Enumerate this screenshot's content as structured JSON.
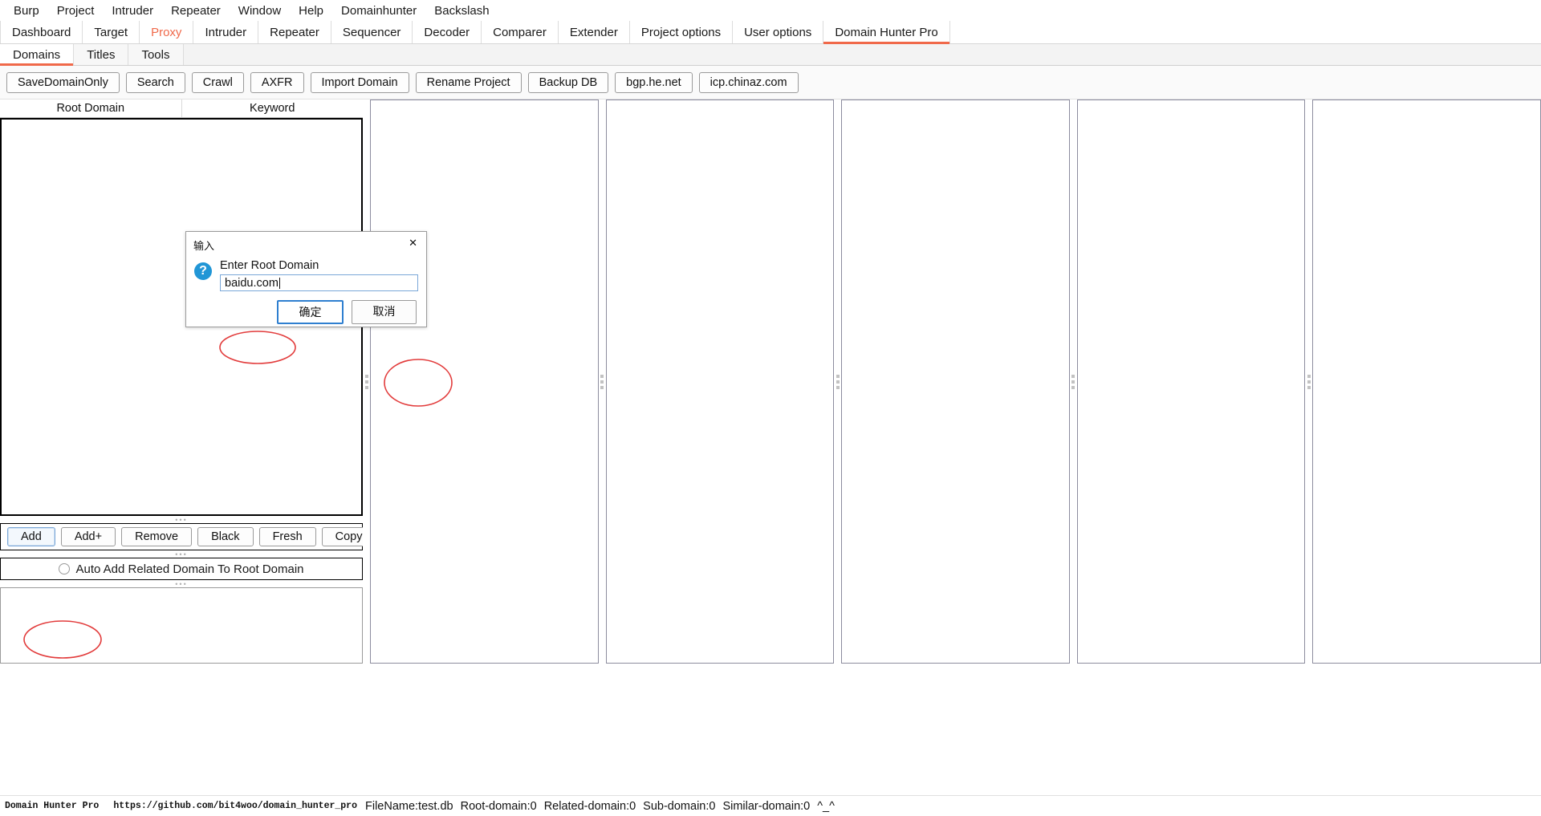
{
  "menubar": {
    "items": [
      {
        "label": "Burp"
      },
      {
        "label": "Project"
      },
      {
        "label": "Intruder"
      },
      {
        "label": "Repeater"
      },
      {
        "label": "Window"
      },
      {
        "label": "Help"
      },
      {
        "label": "Domainhunter"
      },
      {
        "label": "Backslash"
      }
    ]
  },
  "burp_tabs": {
    "items": [
      {
        "label": "Dashboard",
        "selected": false
      },
      {
        "label": "Target",
        "selected": false
      },
      {
        "label": "Proxy",
        "selected": false
      },
      {
        "label": "Intruder",
        "selected": false
      },
      {
        "label": "Repeater",
        "selected": false
      },
      {
        "label": "Sequencer",
        "selected": false
      },
      {
        "label": "Decoder",
        "selected": false
      },
      {
        "label": "Comparer",
        "selected": false
      },
      {
        "label": "Extender",
        "selected": false
      },
      {
        "label": "Project options",
        "selected": false
      },
      {
        "label": "User options",
        "selected": false
      },
      {
        "label": "Domain Hunter Pro",
        "selected": true
      }
    ],
    "accent_color": "#f0694a"
  },
  "sub_tabs": {
    "items": [
      {
        "label": "Domains",
        "selected": true
      },
      {
        "label": "Titles",
        "selected": false
      },
      {
        "label": "Tools",
        "selected": false
      }
    ]
  },
  "toolbar": {
    "buttons": [
      {
        "label": "SaveDomainOnly"
      },
      {
        "label": "Search"
      },
      {
        "label": "Crawl"
      },
      {
        "label": "AXFR"
      },
      {
        "label": "Import Domain"
      },
      {
        "label": "Rename Project"
      },
      {
        "label": "Backup DB"
      },
      {
        "label": "bgp.he.net"
      },
      {
        "label": "icp.chinaz.com"
      }
    ]
  },
  "domain_table": {
    "columns": [
      {
        "label": "Root Domain"
      },
      {
        "label": "Keyword"
      }
    ],
    "rows": []
  },
  "action_buttons": {
    "buttons": [
      {
        "label": "Add",
        "focused": true
      },
      {
        "label": "Add+",
        "focused": false
      },
      {
        "label": "Remove",
        "focused": false
      },
      {
        "label": "Black",
        "focused": false
      },
      {
        "label": "Fresh",
        "focused": false
      },
      {
        "label": "Copy",
        "focused": false
      }
    ]
  },
  "auto_add_option": {
    "label": "Auto Add Related Domain To Root Domain",
    "checked": false
  },
  "right_panels": {
    "count": 5
  },
  "dialog": {
    "title": "输入",
    "close_label": "✕",
    "icon_glyph": "?",
    "prompt": "Enter Root Domain",
    "input_value": "baidu.com",
    "ok_label": "确定",
    "cancel_label": "取消"
  },
  "statusbar": {
    "app_name": "Domain Hunter Pro",
    "url": "https://github.com/bit4woo/domain_hunter_pro",
    "filename": "FileName:test.db",
    "root_domain": "Root-domain:0",
    "related_domain": "Related-domain:0",
    "sub_domain": "Sub-domain:0",
    "similar_domain": "Similar-domain:0",
    "face": "^_^"
  },
  "annotations": {
    "color": "#e23b3b",
    "items": [
      {
        "name": "input-field-highlight"
      },
      {
        "name": "ok-button-highlight"
      },
      {
        "name": "add-button-highlight"
      }
    ]
  }
}
